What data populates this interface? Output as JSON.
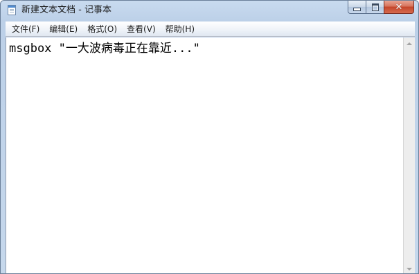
{
  "window": {
    "title": "新建文本文档 - 记事本",
    "app_icon": "notepad-icon"
  },
  "caption_buttons": {
    "minimize_icon": "minimize-icon",
    "maximize_icon": "maximize-icon",
    "close_glyph": "✕"
  },
  "menu": {
    "items": [
      {
        "label": "文件(F)"
      },
      {
        "label": "编辑(E)"
      },
      {
        "label": "格式(O)"
      },
      {
        "label": "查看(V)"
      },
      {
        "label": "帮助(H)"
      }
    ]
  },
  "editor": {
    "content": "msgbox \"一大波病毒正在靠近...\""
  },
  "colors": {
    "titlebar": "#c9dbef",
    "close_button": "#c4452a",
    "editor_background": "#ffffff"
  }
}
